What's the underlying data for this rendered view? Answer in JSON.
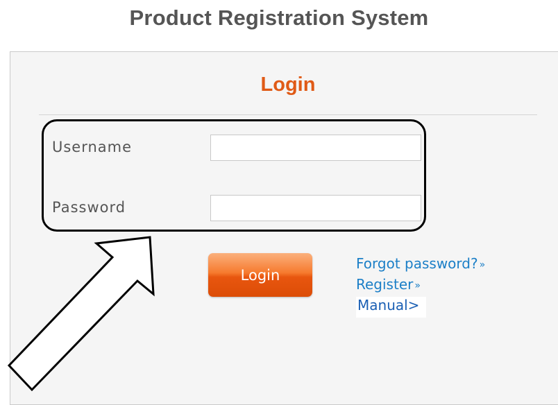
{
  "header": {
    "title": "Product Registration System"
  },
  "login_panel": {
    "title": "Login",
    "username_label": "Username",
    "password_label": "Password",
    "username_value": "",
    "password_value": "",
    "login_button": "Login"
  },
  "links": {
    "forgot_password": "Forgot password?",
    "register": "Register",
    "manual": "Manual>",
    "chevron": "»"
  },
  "colors": {
    "accent": "#e05a16",
    "link": "#1c7fc7",
    "title_gray": "#555555"
  },
  "annotation": {
    "arrow_icon": "outline-arrow-icon",
    "highlight": "rounded-highlight-box"
  }
}
